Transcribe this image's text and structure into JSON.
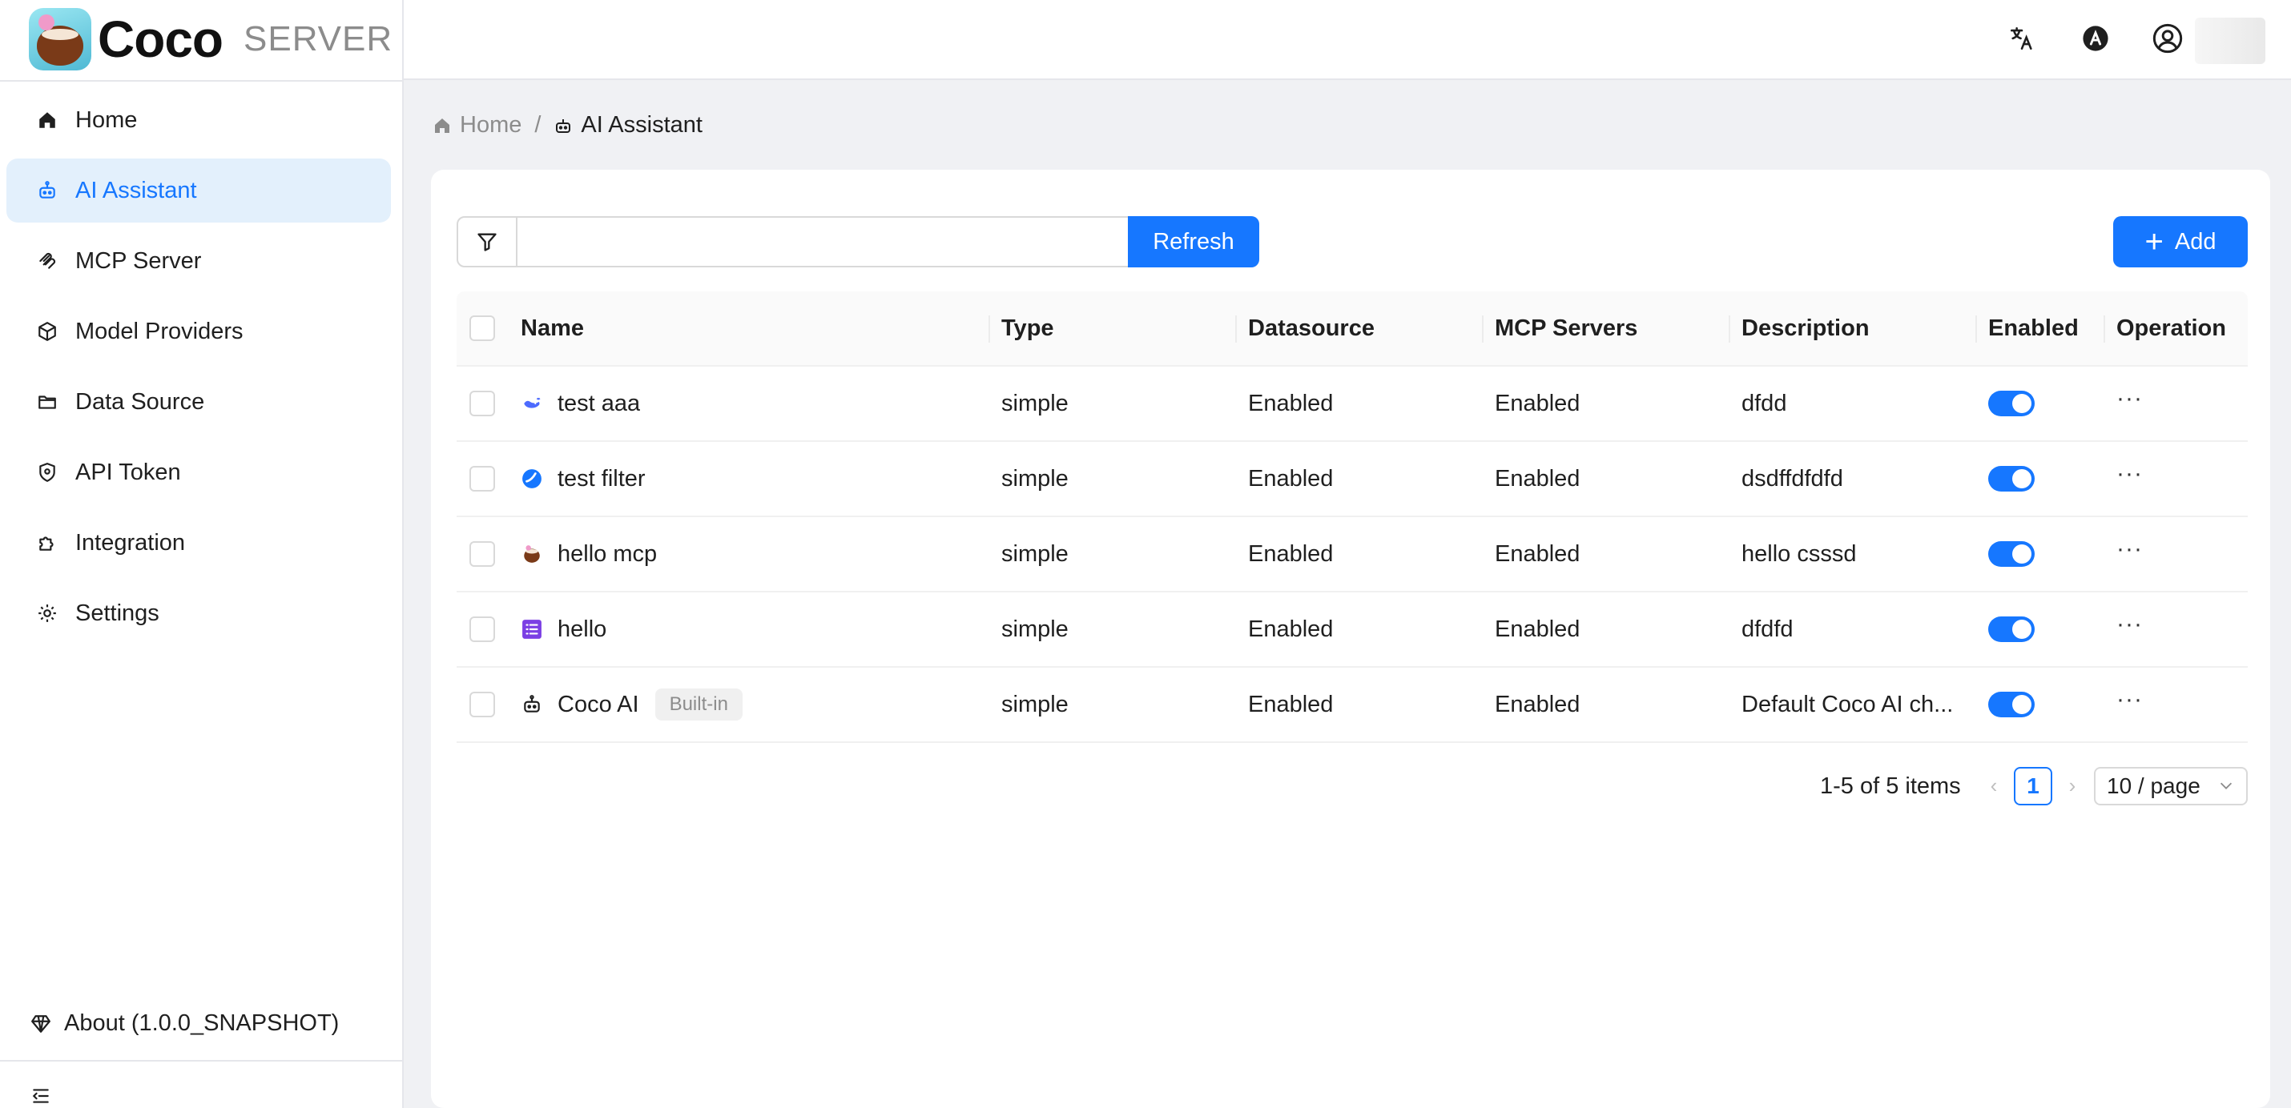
{
  "brand": {
    "name": "Coco",
    "subtitle": "SERVER"
  },
  "sidebar": {
    "items": [
      {
        "label": "Home",
        "icon": "home-icon"
      },
      {
        "label": "AI Assistant",
        "icon": "robot-icon",
        "active": true
      },
      {
        "label": "MCP Server",
        "icon": "mcp-icon"
      },
      {
        "label": "Model Providers",
        "icon": "cube-icon"
      },
      {
        "label": "Data Source",
        "icon": "folder-icon"
      },
      {
        "label": "API Token",
        "icon": "shield-icon"
      },
      {
        "label": "Integration",
        "icon": "puzzle-icon"
      },
      {
        "label": "Settings",
        "icon": "gear-icon"
      }
    ],
    "about": "About (1.0.0_SNAPSHOT)"
  },
  "topbar": {
    "icons": [
      "translate-icon",
      "theme-icon",
      "user-icon"
    ]
  },
  "breadcrumb": {
    "home": "Home",
    "current": "AI Assistant"
  },
  "toolbar": {
    "search_value": "",
    "refresh_label": "Refresh",
    "add_label": "Add"
  },
  "table": {
    "columns": [
      "Name",
      "Type",
      "Datasource",
      "MCP Servers",
      "Description",
      "Enabled",
      "Operation"
    ],
    "rows": [
      {
        "name": "test aaa",
        "icon": "whale-icon",
        "type": "simple",
        "datasource": "Enabled",
        "mcp_servers": "Enabled",
        "description": "dfdd",
        "enabled": true
      },
      {
        "name": "test filter",
        "icon": "blue-circle-icon",
        "type": "simple",
        "datasource": "Enabled",
        "mcp_servers": "Enabled",
        "description": "dsdffdfdfd",
        "enabled": true
      },
      {
        "name": "hello mcp",
        "icon": "coconut-icon",
        "type": "simple",
        "datasource": "Enabled",
        "mcp_servers": "Enabled",
        "description": "hello csssd",
        "enabled": true
      },
      {
        "name": "hello",
        "icon": "list-icon",
        "type": "simple",
        "datasource": "Enabled",
        "mcp_servers": "Enabled",
        "description": "dfdfd",
        "enabled": true
      },
      {
        "name": "Coco AI",
        "icon": "robot-icon",
        "tag": "Built-in",
        "type": "simple",
        "datasource": "Enabled",
        "mcp_servers": "Enabled",
        "description": "Default Coco AI ch...",
        "enabled": true
      }
    ],
    "operation_label": "···"
  },
  "pagination": {
    "total": "1-5 of 5 items",
    "current_page": "1",
    "page_size": "10 / page"
  },
  "colors": {
    "accent": "#1677ff",
    "active_bg": "#e3f0fc",
    "page_bg": "#f0f1f4"
  }
}
